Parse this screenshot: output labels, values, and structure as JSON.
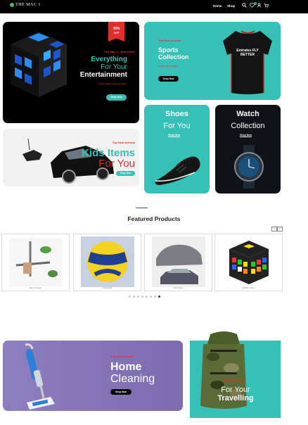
{
  "nav": {
    "logo": "THE MAC 1",
    "links": [
      "Home",
      "Shop"
    ],
    "cart_count": "0"
  },
  "banners": {
    "entertainment": {
      "discount": "35%",
      "discount_label": "OFF",
      "eyebrow": "The Mac 1 - Best Seller",
      "line1": "Everything",
      "line2": "For Your",
      "line3": "Entertainment",
      "fine": "Lorem ipsum dolor sit amet.",
      "button": "Shop Now"
    },
    "sports": {
      "eyebrow": "Top New Arrivals",
      "line1": "Sports",
      "line2": "Collection",
      "fine": "Lorem ipsum dolor",
      "button": "Shop Now",
      "jersey_text": "Emirates FLY BETTER"
    },
    "shoes": {
      "line1": "Shoes",
      "line2": "For You",
      "link": "Shop Now"
    },
    "watch": {
      "line1": "Watch",
      "line2": "Collection",
      "link": "Shop Now"
    },
    "kids": {
      "eyebrow": "Top New Arrivals",
      "line1": "Kids Items",
      "line2": "For You",
      "button": "Shop Now"
    },
    "home": {
      "eyebrow": "Top New Arrivals",
      "line1": "Home",
      "line2": "Cleaning",
      "button": "Shop Now"
    },
    "travel": {
      "eyebrow": "Top New Arrivals",
      "line1": "For Your",
      "line2": "Travelling"
    }
  },
  "featured": {
    "title": "Featured Products",
    "arrow_prev": "‹",
    "arrow_next": "›",
    "items": [
      "Decor Figure",
      "Volleyball",
      "Car Cover",
      "Rubik's Cube"
    ],
    "active_page": 7,
    "page_count": 8
  },
  "colors": {
    "accent": "#36c1b6",
    "red": "#e32d2d",
    "dark": "#000000"
  }
}
